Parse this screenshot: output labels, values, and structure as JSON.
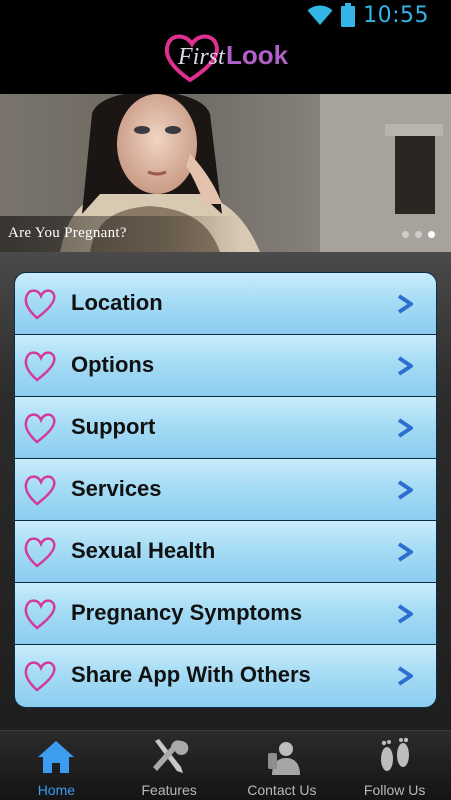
{
  "status": {
    "time": "10:55"
  },
  "header": {
    "logo_first": "First",
    "logo_look": "Look"
  },
  "banner": {
    "caption": "Are You Pregnant?",
    "slide_count": 3,
    "active_slide": 3
  },
  "menu": {
    "items": [
      {
        "label": "Location"
      },
      {
        "label": "Options"
      },
      {
        "label": "Support"
      },
      {
        "label": "Services"
      },
      {
        "label": "Sexual Health"
      },
      {
        "label": "Pregnancy Symptoms"
      },
      {
        "label": "Share App With Others"
      }
    ]
  },
  "tabbar": {
    "tabs": [
      {
        "label": "Home",
        "icon": "home-icon",
        "active": true
      },
      {
        "label": "Features",
        "icon": "tools-icon",
        "active": false
      },
      {
        "label": "Contact Us",
        "icon": "contact-icon",
        "active": false
      },
      {
        "label": "Follow Us",
        "icon": "footprints-icon",
        "active": false
      }
    ]
  },
  "colors": {
    "accent": "#33b5e5",
    "heart": "#d23a9c",
    "chevron": "#2d6fd0",
    "menu_bg": "#a6dcf5",
    "active_tab": "#3b9cf0"
  }
}
